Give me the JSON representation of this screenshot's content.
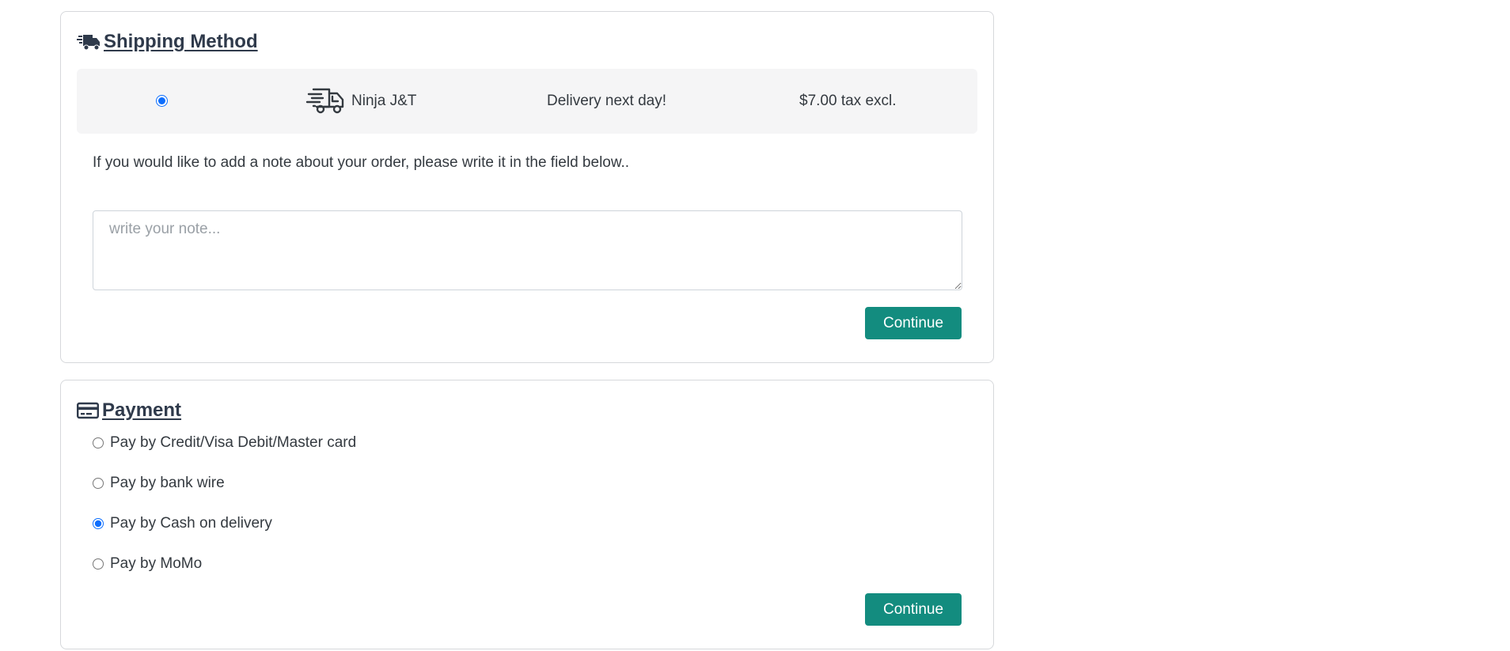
{
  "shipping": {
    "title": "Shipping Method",
    "title_icon": "shipping-fast-icon",
    "carrier": {
      "selected": true,
      "icon": "delivery-truck-icon",
      "name": "Ninja J&T",
      "delay": "Delivery next day!",
      "price": "$7.00 tax excl."
    },
    "note_label": "If you would like to add a note about your order, please write it in the field below..",
    "note_value": "",
    "note_placeholder": "write your note...",
    "continue_label": "Continue"
  },
  "payment": {
    "title": "Payment",
    "title_icon": "credit-card-icon",
    "options": [
      {
        "label": "Pay by Credit/Visa Debit/Master card",
        "selected": false
      },
      {
        "label": "Pay by bank wire",
        "selected": false
      },
      {
        "label": "Pay by Cash on delivery",
        "selected": true
      },
      {
        "label": "Pay by MoMo",
        "selected": false
      }
    ],
    "continue_label": "Continue"
  },
  "colors": {
    "accent_button": "#138c7f",
    "radio_selected": "#0d6efd",
    "title_text": "#2f3a4b",
    "carrier_row_bg": "#f5f5f6",
    "card_border": "#d6d8db"
  }
}
